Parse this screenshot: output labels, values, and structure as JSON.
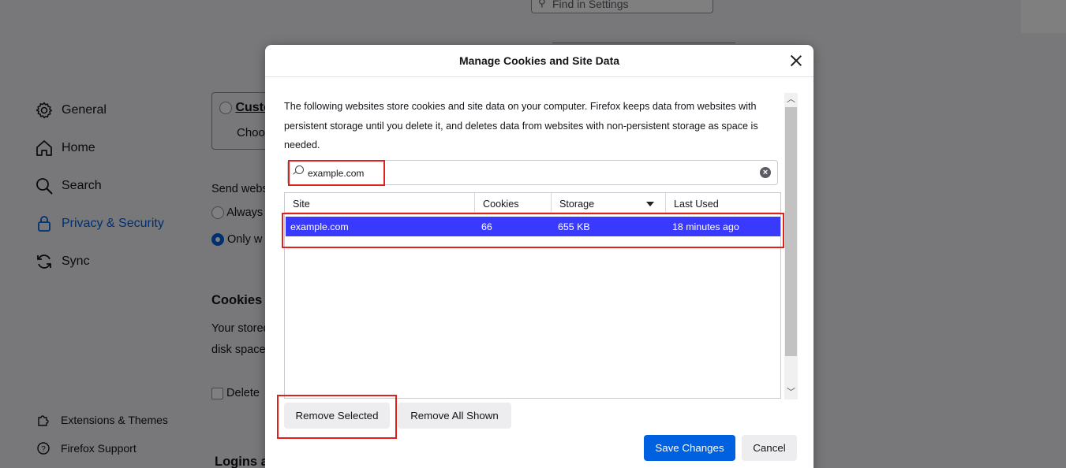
{
  "background": {
    "find_placeholder": "Find in Settings",
    "nav": [
      {
        "label": "General",
        "icon": "gear-icon"
      },
      {
        "label": "Home",
        "icon": "home-icon"
      },
      {
        "label": "Search",
        "icon": "search-icon"
      },
      {
        "label": "Privacy & Security",
        "icon": "lock-icon",
        "active": true
      },
      {
        "label": "Sync",
        "icon": "sync-icon"
      }
    ],
    "footer": [
      {
        "label": "Extensions & Themes",
        "icon": "puzzle-icon"
      },
      {
        "label": "Firefox Support",
        "icon": "help-icon"
      }
    ],
    "custom_label": "Custo",
    "choose_label": "Choo",
    "send_label": "Send webs",
    "always_label": "Always",
    "only_label": "Only w",
    "cookies_heading": "Cookies a",
    "stored_line1": "Your stored",
    "stored_line2": "disk space",
    "delete_label": "Delete",
    "logins_heading": "Logins a"
  },
  "dialog": {
    "title": "Manage Cookies and Site Data",
    "description": "The following websites store cookies and site data on your computer. Firefox keeps data from websites with persistent storage until you delete it, and deletes data from websites with non-persistent storage as space is needed.",
    "search_value": "example.com",
    "columns": [
      "Site",
      "Cookies",
      "Storage",
      "Last Used"
    ],
    "sorted_column": "Storage",
    "rows": [
      {
        "site": "example.com",
        "cookies": "66",
        "storage": "655 KB",
        "last_used": "18 minutes ago",
        "selected": true
      }
    ],
    "buttons": {
      "remove_selected": "Remove Selected",
      "remove_all_shown": "Remove All Shown",
      "save_changes": "Save Changes",
      "cancel": "Cancel"
    }
  },
  "colors": {
    "accent": "#0061e0",
    "selection": "#3a3aff",
    "highlight": "#e0201c"
  }
}
